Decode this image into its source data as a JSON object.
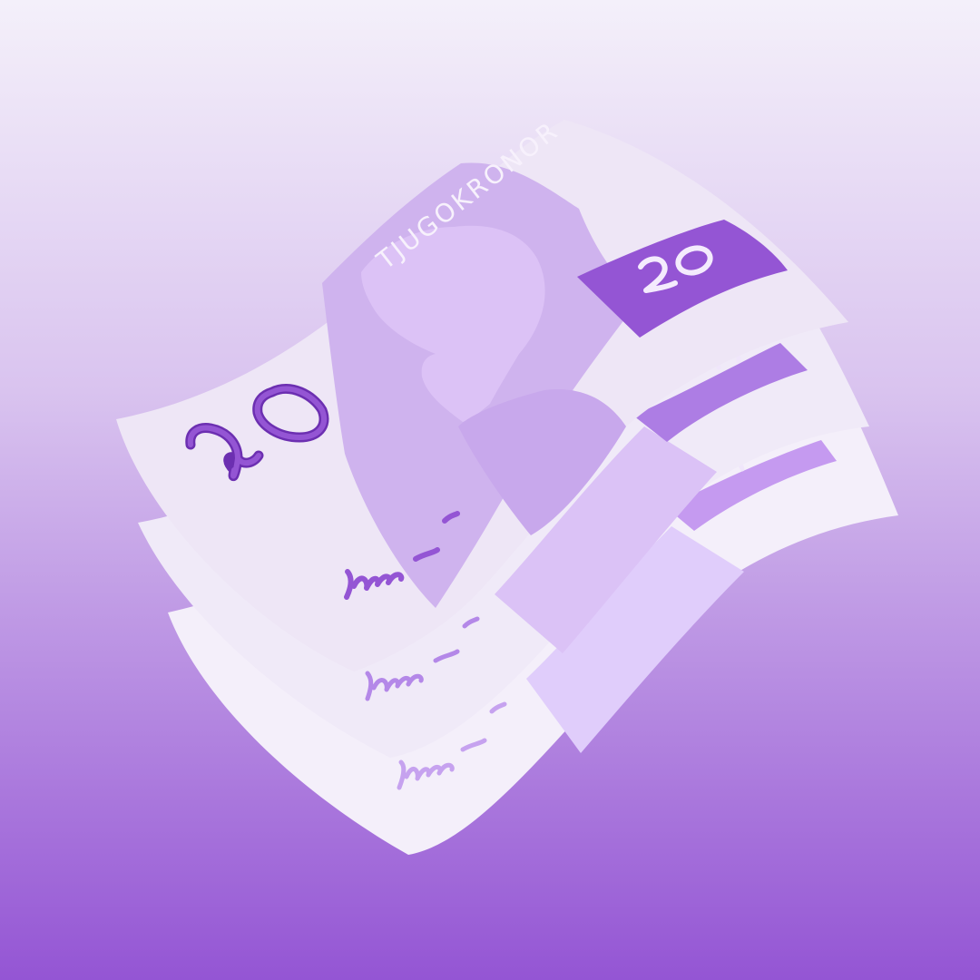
{
  "illustration": {
    "subject": "stack-of-banknotes",
    "colors": {
      "background_top": "#f4f0fa",
      "background_bottom": "#9455d4",
      "note_paper_back": "#f4effa",
      "note_paper_mid": "#f0eaf8",
      "note_paper_front": "#eee6f6",
      "portrait_band": "#cfb3ee",
      "portrait_band_light": "#dfc9f7",
      "denomination_ribbon": "#9455d4",
      "denomination_ribbon_mid": "#ad7de4",
      "denomination_ribbon_back": "#c59af0",
      "ink": "#9455d4",
      "ink_light": "#c6a2ef",
      "marker_outline": "#6c2fb1"
    },
    "notes": [
      {
        "layer": "back",
        "denomination": "20"
      },
      {
        "layer": "middle",
        "denomination": "20"
      },
      {
        "layer": "front",
        "denomination": "20",
        "corner_denomination": "20",
        "serial_text": "TJUGOKRONOR"
      }
    ]
  }
}
